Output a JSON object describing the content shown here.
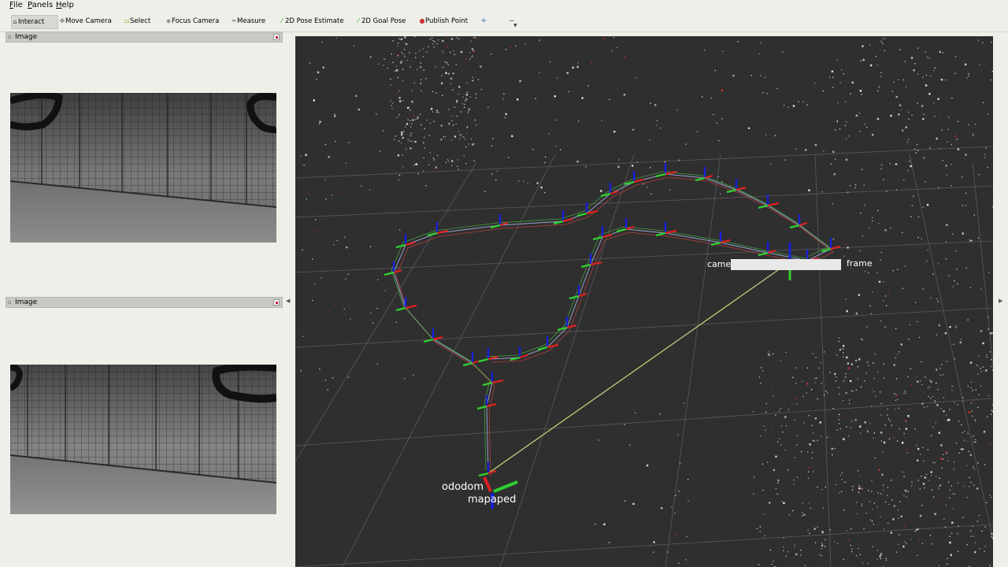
{
  "menu": [
    {
      "label": "File",
      "mnemonic": "F",
      "rest": "ile"
    },
    {
      "label": "Panels",
      "mnemonic": "P",
      "rest": "anels"
    },
    {
      "label": "Help",
      "mnemonic": "H",
      "rest": "elp"
    }
  ],
  "toolbar": {
    "tools": [
      {
        "label": "Interact",
        "icon": "cursor-icon",
        "active": true
      },
      {
        "label": "Move Camera",
        "icon": "move-camera-icon",
        "active": false
      },
      {
        "label": "Select",
        "icon": "select-icon",
        "active": false
      },
      {
        "label": "Focus Camera",
        "icon": "focus-camera-icon",
        "active": false
      },
      {
        "label": "Measure",
        "icon": "measure-icon",
        "active": false
      },
      {
        "label": "2D Pose Estimate",
        "icon": "pose-estimate-icon",
        "active": false
      },
      {
        "label": "2D Goal Pose",
        "icon": "goal-pose-icon",
        "active": false
      },
      {
        "label": "Publish Point",
        "icon": "publish-point-icon",
        "active": false
      }
    ],
    "add_tool": "+",
    "remove_tool": "−"
  },
  "panels": [
    {
      "title": "Image"
    },
    {
      "title": "Image"
    }
  ],
  "viewport": {
    "labels": {
      "odom": "ododom",
      "map": "mapaped",
      "camera": "came",
      "frame": "frame"
    },
    "colors": {
      "background": "#2f2f2f",
      "grid": "#5a5a5a",
      "axis_x": "#e02020",
      "axis_y": "#30d030",
      "axis_z": "#1820d8",
      "odom_link": "#c8c87a"
    }
  }
}
